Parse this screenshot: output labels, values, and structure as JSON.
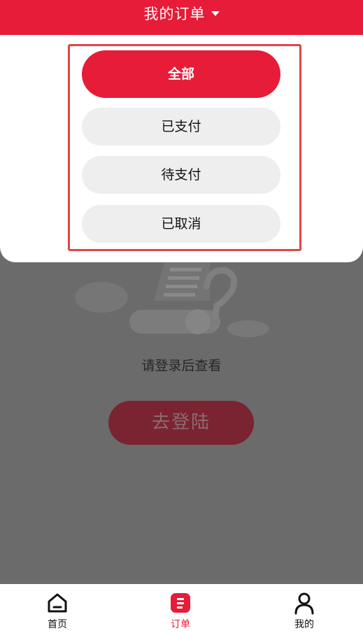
{
  "header": {
    "title": "我的订单"
  },
  "filter": {
    "options": [
      {
        "label": "全部",
        "active": true
      },
      {
        "label": "已支付",
        "active": false
      },
      {
        "label": "待支付",
        "active": false
      },
      {
        "label": "已取消",
        "active": false
      }
    ]
  },
  "empty_state": {
    "hint": "请登录后查看",
    "login_button": "去登陆"
  },
  "tabbar": {
    "items": [
      {
        "label": "首页",
        "icon": "home-icon",
        "active": false
      },
      {
        "label": "订单",
        "icon": "order-icon",
        "active": true
      },
      {
        "label": "我的",
        "icon": "profile-icon",
        "active": false
      }
    ]
  },
  "colors": {
    "brand": "#e61c39",
    "overlay": "#6b6b6b",
    "highlight_border": "#e14545"
  }
}
